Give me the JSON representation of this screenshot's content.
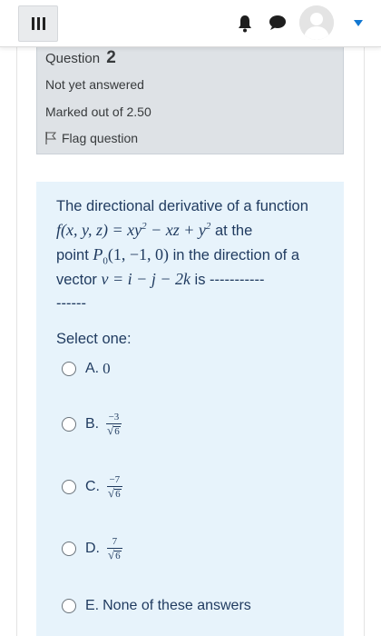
{
  "navbar": {
    "menu_icon": "hamburger-icon",
    "notification_icon": "bell-icon",
    "messages_icon": "chat-icon",
    "user_icon": "avatar",
    "dropdown_icon": "caret-down-icon"
  },
  "question_info": {
    "label": "Question",
    "number": "2",
    "state": "Not yet answered",
    "grade": "Marked out of 2.50",
    "flag_label": "Flag question"
  },
  "question": {
    "text_1": "The directional derivative of a function",
    "func_lhs": "f(x, y, z) = xy",
    "func_mid": " − xz + y",
    "exp": "2",
    "text_2": " at the",
    "text_3": "point ",
    "point_name": "P",
    "point_sub": "0",
    "point_coords": "(1, −1, 0)",
    "text_4": " in the direction of a",
    "text_5": "vector ",
    "vector_expr": "v = i − j − 2k",
    "text_6": " is -----------",
    "text_7": "------"
  },
  "answers": {
    "prompt": "Select one:",
    "options": [
      {
        "letter": "A.",
        "value": "0"
      },
      {
        "letter": "B.",
        "num": "−3",
        "den": "6"
      },
      {
        "letter": "C.",
        "num": "−7",
        "den": "6"
      },
      {
        "letter": "D.",
        "num": "7",
        "den": "6"
      },
      {
        "letter": "E.",
        "text": "None of these answers"
      }
    ]
  },
  "colors": {
    "info_bg": "#dee2e6",
    "content_bg": "#e7f3fb",
    "text": "#1f3a5f"
  }
}
